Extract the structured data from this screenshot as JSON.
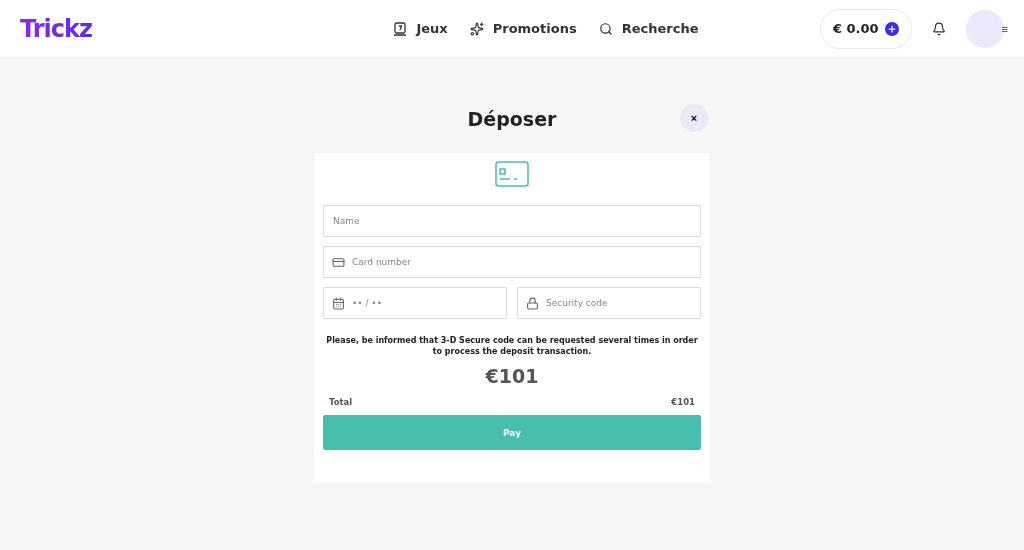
{
  "header": {
    "logo": "Trickz",
    "nav": [
      {
        "kind": "games",
        "label": "Jeux"
      },
      {
        "kind": "promotions",
        "label": "Promotions"
      },
      {
        "kind": "search",
        "label": "Recherche"
      }
    ],
    "balance": "€ 0.00",
    "menu_icon": "≡"
  },
  "modal": {
    "title": "Déposer",
    "close": "×",
    "fields": [
      {
        "kind": "name",
        "placeholder": "Name"
      },
      {
        "kind": "card",
        "placeholder": "Card number"
      }
    ],
    "row_fields": [
      {
        "kind": "expiry",
        "placeholder": "•• / ••"
      },
      {
        "kind": "cvc",
        "placeholder": "Security code"
      }
    ],
    "notice": "Please, be informed that 3-D Secure code can be requested several times in order to process the deposit transaction.",
    "amount": "€101",
    "total_label": "Total",
    "total_value": "€101",
    "pay": "Pay"
  }
}
